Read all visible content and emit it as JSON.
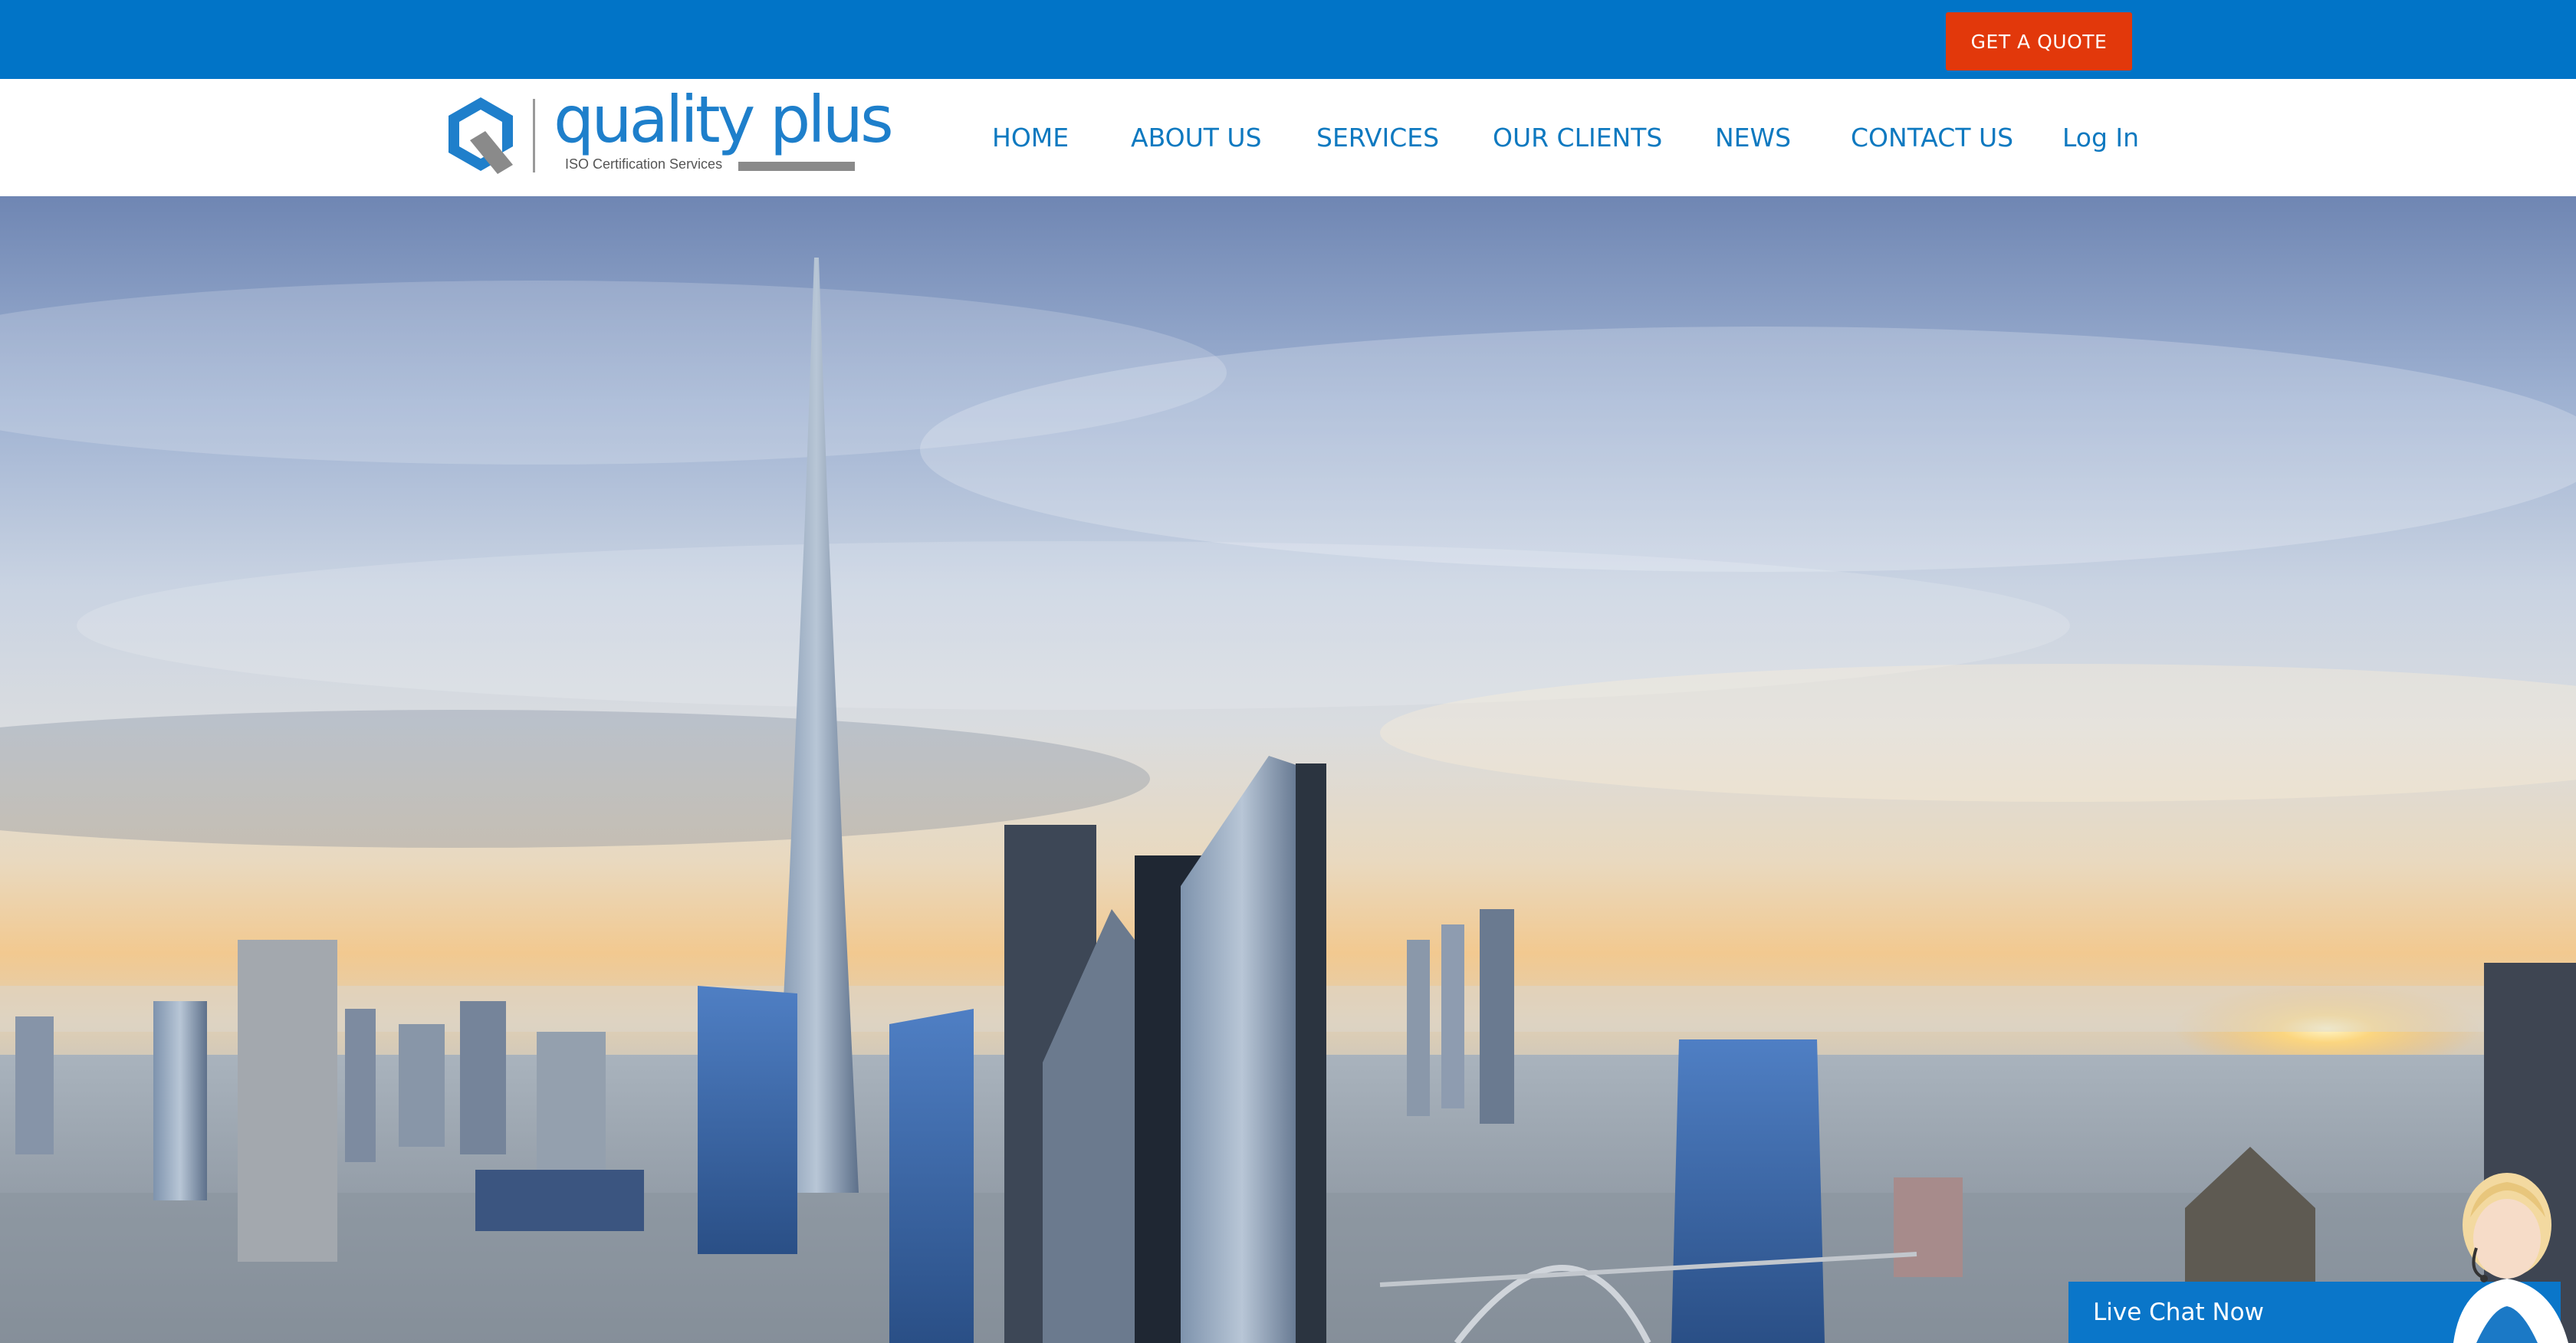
{
  "top_bar": {
    "quote_label": "GET A QUOTE",
    "accent_color": "#0174c7",
    "button_color": "#e2380b"
  },
  "logo": {
    "wordmark": "quality plus",
    "tagline": "ISO Certification Services",
    "icon": "q-logo-icon"
  },
  "nav": {
    "items": [
      {
        "label": "HOME"
      },
      {
        "label": "ABOUT US"
      },
      {
        "label": "SERVICES"
      },
      {
        "label": "OUR CLIENTS"
      },
      {
        "label": "NEWS"
      },
      {
        "label": "CONTACT US"
      },
      {
        "label": "Log In"
      }
    ],
    "text_color": "#0e79c0"
  },
  "hero": {
    "image": "city-skyline-sunset"
  },
  "chat": {
    "label": "Live Chat Now",
    "avatar": "support-agent-avatar"
  }
}
